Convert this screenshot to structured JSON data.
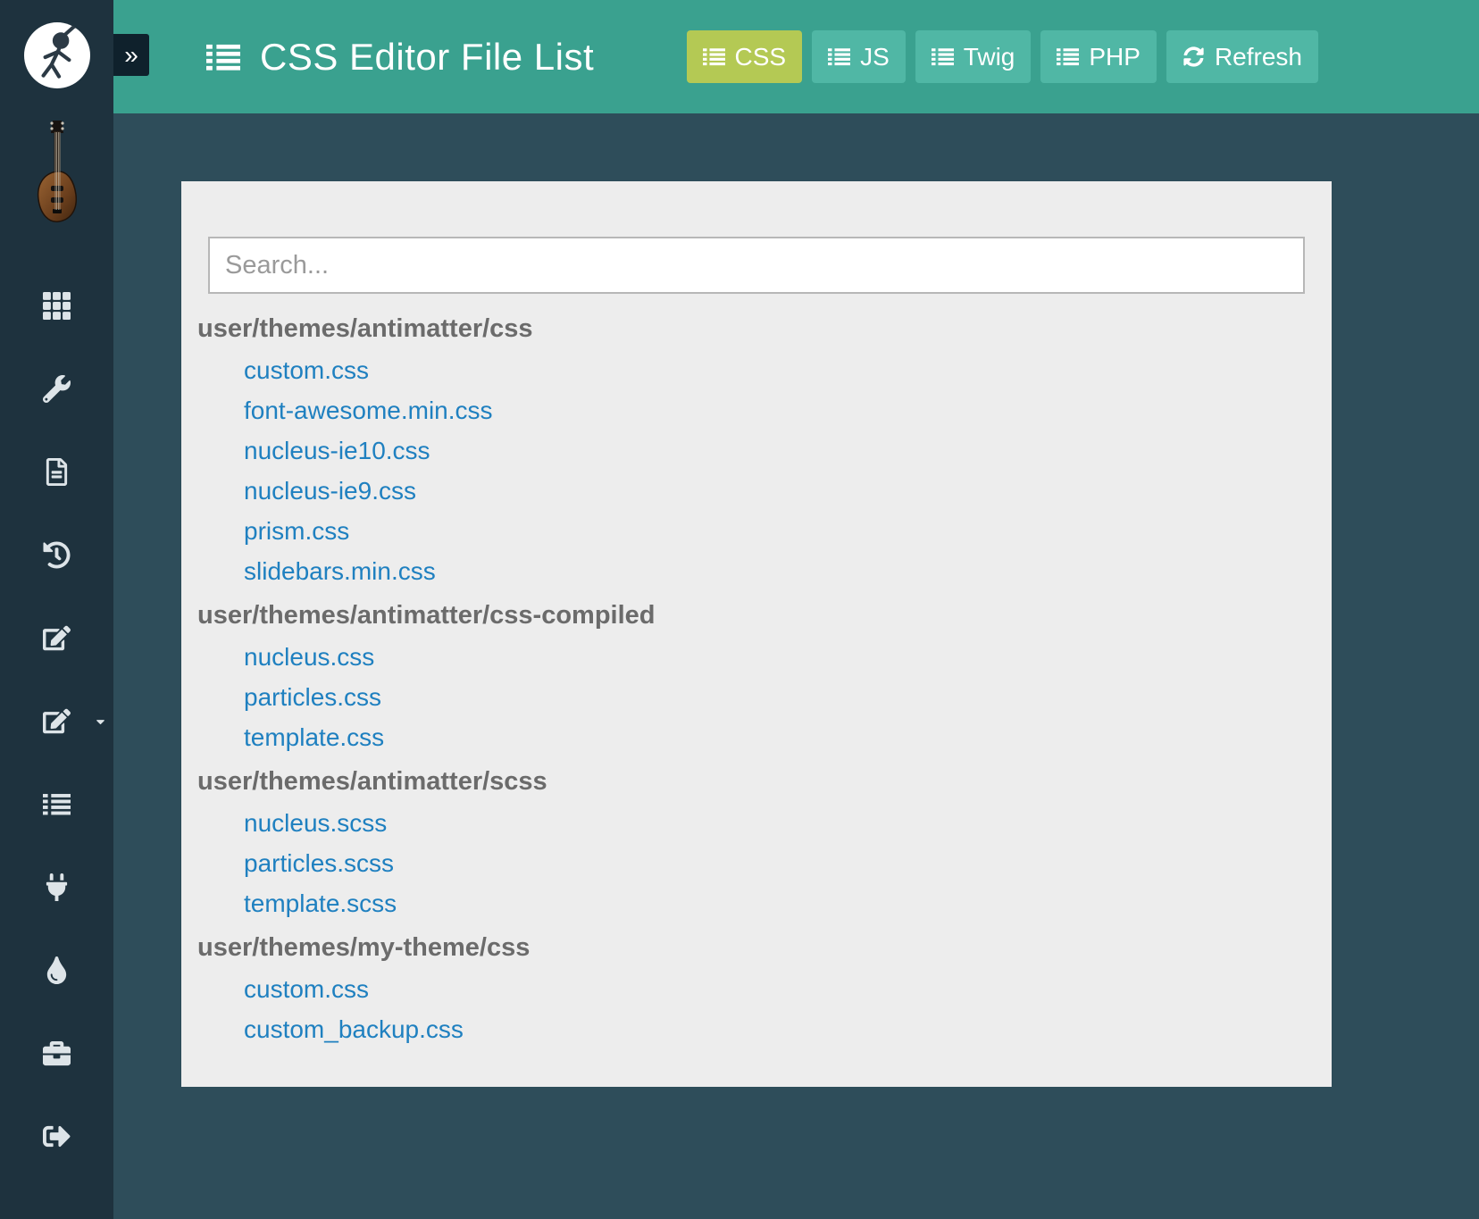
{
  "sidebar": {
    "expand_glyph": "»",
    "items": [
      {
        "name": "dashboard",
        "icon": "grid-icon"
      },
      {
        "name": "configuration",
        "icon": "wrench-icon"
      },
      {
        "name": "pages",
        "icon": "file-icon"
      },
      {
        "name": "history",
        "icon": "history-icon"
      },
      {
        "name": "editor",
        "icon": "edit-icon"
      },
      {
        "name": "css-editor",
        "icon": "edit-icon",
        "caret": "caret-down-icon"
      },
      {
        "name": "file-list",
        "icon": "list-icon"
      },
      {
        "name": "plugins",
        "icon": "plug-icon"
      },
      {
        "name": "themes",
        "icon": "droplet-icon"
      },
      {
        "name": "tools",
        "icon": "briefcase-icon"
      },
      {
        "name": "logout",
        "icon": "sign-out-icon"
      }
    ]
  },
  "header": {
    "title": "CSS Editor File List",
    "title_icon": "list-icon",
    "buttons": [
      {
        "label": "CSS",
        "icon": "list-icon",
        "active": true
      },
      {
        "label": "JS",
        "icon": "list-icon",
        "active": false
      },
      {
        "label": "Twig",
        "icon": "list-icon",
        "active": false
      },
      {
        "label": "PHP",
        "icon": "list-icon",
        "active": false
      }
    ],
    "refresh": {
      "label": "Refresh",
      "icon": "refresh-icon"
    }
  },
  "search": {
    "placeholder": "Search...",
    "value": ""
  },
  "files": {
    "groups": [
      {
        "path": "user/themes/antimatter/css",
        "files": [
          "custom.css",
          "font-awesome.min.css",
          "nucleus-ie10.css",
          "nucleus-ie9.css",
          "prism.css",
          "slidebars.min.css"
        ]
      },
      {
        "path": "user/themes/antimatter/css-compiled",
        "files": [
          "nucleus.css",
          "particles.css",
          "template.css"
        ]
      },
      {
        "path": "user/themes/antimatter/scss",
        "files": [
          "nucleus.scss",
          "particles.scss",
          "template.scss"
        ]
      },
      {
        "path": "user/themes/my-theme/css",
        "files": [
          "custom.css",
          "custom_backup.css"
        ]
      }
    ]
  },
  "colors": {
    "header_teal": "#3aa18f",
    "button_teal": "#50b7a5",
    "active_button_green": "#b4c954",
    "content_background": "#2e4d5a",
    "sidebar_background": "#1e323e",
    "panel_background": "#ededed",
    "link_blue": "#1f80c0"
  }
}
